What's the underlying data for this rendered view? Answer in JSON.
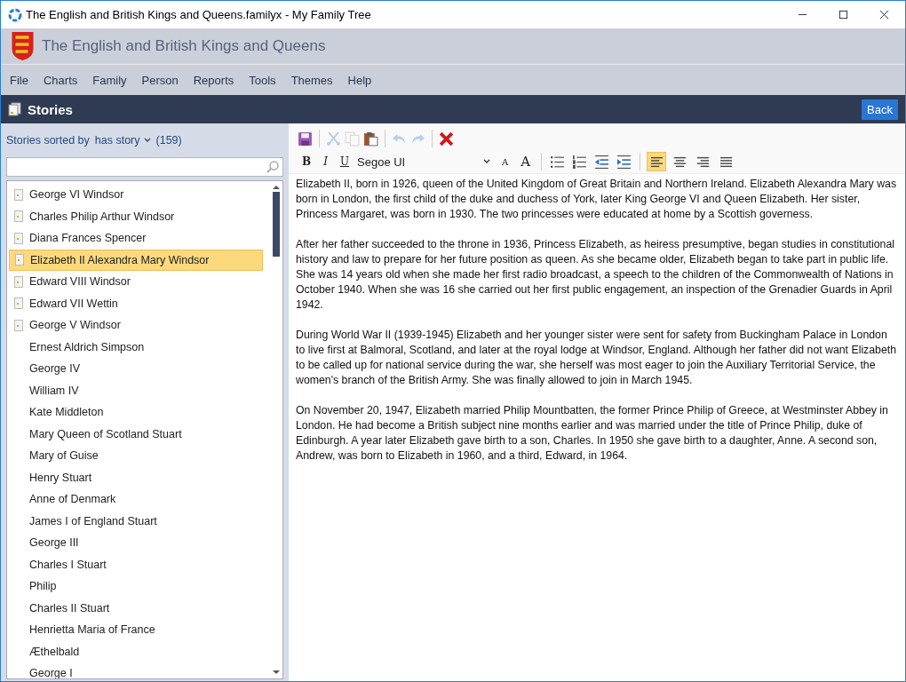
{
  "window": {
    "title": "The English and British Kings and Queens.familyx - My Family Tree"
  },
  "header": {
    "title": "The English and British Kings and Queens"
  },
  "menu": [
    "File",
    "Charts",
    "Family",
    "Person",
    "Reports",
    "Tools",
    "Themes",
    "Help"
  ],
  "page": {
    "title": "Stories",
    "back": "Back"
  },
  "sidebar": {
    "label": "Stories sorted by",
    "sort": "has story",
    "count": "(159)",
    "items": [
      {
        "name": "George VI Windsor",
        "has_story": true,
        "selected": false
      },
      {
        "name": "Charles Philip Arthur Windsor",
        "has_story": true,
        "selected": false
      },
      {
        "name": "Diana Frances Spencer",
        "has_story": true,
        "selected": false
      },
      {
        "name": "Elizabeth II Alexandra Mary Windsor",
        "has_story": true,
        "selected": true
      },
      {
        "name": "Edward VIII Windsor",
        "has_story": true,
        "selected": false
      },
      {
        "name": "Edward VII Wettin",
        "has_story": true,
        "selected": false
      },
      {
        "name": "George V Windsor",
        "has_story": true,
        "selected": false
      },
      {
        "name": "Ernest Aldrich Simpson",
        "has_story": false,
        "selected": false
      },
      {
        "name": "George IV",
        "has_story": false,
        "selected": false
      },
      {
        "name": "William IV",
        "has_story": false,
        "selected": false
      },
      {
        "name": "Kate Middleton",
        "has_story": false,
        "selected": false
      },
      {
        "name": "Mary Queen of Scotland Stuart",
        "has_story": false,
        "selected": false
      },
      {
        "name": "Mary of Guise",
        "has_story": false,
        "selected": false
      },
      {
        "name": "Henry Stuart",
        "has_story": false,
        "selected": false
      },
      {
        "name": "Anne of Denmark",
        "has_story": false,
        "selected": false
      },
      {
        "name": "James I of England Stuart",
        "has_story": false,
        "selected": false
      },
      {
        "name": "George III",
        "has_story": false,
        "selected": false
      },
      {
        "name": "Charles I Stuart",
        "has_story": false,
        "selected": false
      },
      {
        "name": "Philip",
        "has_story": false,
        "selected": false
      },
      {
        "name": "Charles II Stuart",
        "has_story": false,
        "selected": false
      },
      {
        "name": "Henrietta Maria of France",
        "has_story": false,
        "selected": false
      },
      {
        "name": "Æthelbald",
        "has_story": false,
        "selected": false
      },
      {
        "name": "George I",
        "has_story": false,
        "selected": false
      }
    ]
  },
  "toolbar": [
    {
      "kind": "save",
      "disabled": false
    },
    {
      "kind": "cut",
      "disabled": true
    },
    {
      "kind": "copy",
      "disabled": true
    },
    {
      "kind": "paste",
      "disabled": false
    },
    {
      "kind": "undo",
      "disabled": true
    },
    {
      "kind": "redo",
      "disabled": true
    },
    {
      "kind": "delete",
      "disabled": false
    }
  ],
  "format": {
    "bold": "B",
    "italic": "I",
    "underline": "U",
    "font": "Segoe UI",
    "shrink": "A",
    "grow": "A",
    "align": [
      {
        "kind": "left",
        "selected": true
      },
      {
        "kind": "center",
        "selected": false
      },
      {
        "kind": "right",
        "selected": false
      },
      {
        "kind": "justify",
        "selected": false
      }
    ]
  },
  "story": [
    "Elizabeth II, born in 1926, queen of the United Kingdom of Great Britain and Northern Ireland. Elizabeth Alexandra Mary was born in London, the first child of the duke and duchess of York, later King George VI and Queen Elizabeth. Her sister, Princess Margaret, was born in 1930. The two princesses were educated at home by a Scottish governess.",
    "After her father succeeded to the throne in 1936, Princess Elizabeth, as heiress presumptive, began studies in constitutional history and law to prepare for her future position as queen. As she became older, Elizabeth began to take part in public life. She was 14 years old when she made her first radio broadcast, a speech to the children of the Commonwealth of Nations in October 1940. When she was 16 she carried out her first public engagement, an inspection of the Grenadier Guards in April 1942.",
    "During World War II (1939-1945) Elizabeth and her younger sister were sent for safety from Buckingham Palace in London to live first at Balmoral, Scotland, and later at the royal lodge at Windsor, England. Although her father did not want Elizabeth to be called up for national service during the war, she herself was most eager to join the Auxiliary Territorial Service, the women's branch of the British Army. She was finally allowed to join in March 1945.",
    "On November 20, 1947, Elizabeth married Philip Mountbatten, the former Prince Philip of Greece, at Westminster Abbey in London. He had become a British subject nine months earlier and was married under the title of Prince Philip, duke of Edinburgh. A year later Elizabeth gave birth to a son, Charles. In 1950 she gave birth to a daughter, Anne. A second son, Andrew, was born to Elizabeth in 1960, and a third, Edward, in 1964."
  ]
}
